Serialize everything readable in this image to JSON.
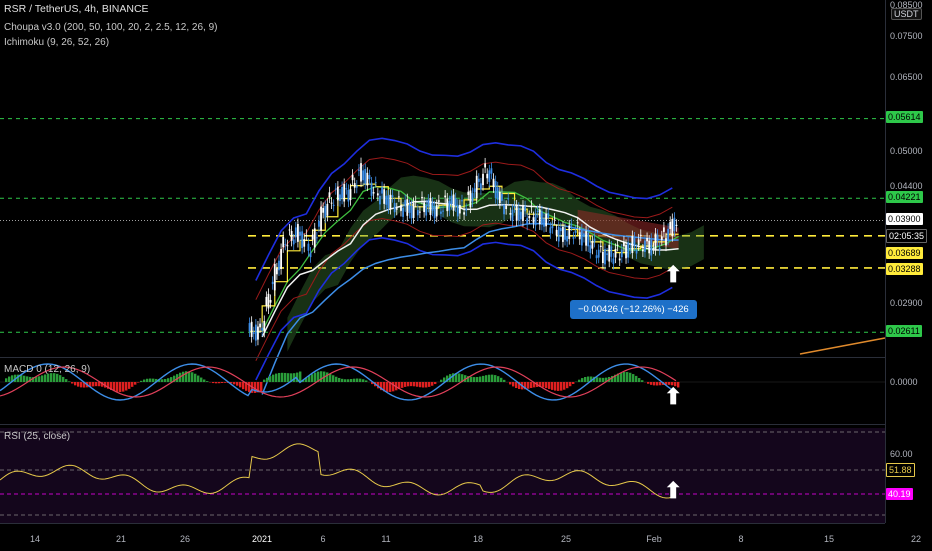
{
  "header": {
    "title": "RSR / TetherUS, 4h, BINANCE",
    "indicator1": "Choupa v3.0 (200, 50, 100, 20, 2, 2.5, 12, 26, 9)",
    "indicator2": "Ichimoku (9, 26, 52, 26)"
  },
  "price_axis": {
    "currency": "USDT",
    "ticks": [
      "0.08500",
      "0.07500",
      "0.06500",
      "0.05000",
      "0.04400",
      "0.02900"
    ],
    "tags": {
      "top_green": "0.05614",
      "upper_green": "0.04221",
      "last": "0.03900",
      "countdown": "02:05:35",
      "yellow_upper": "0.03689",
      "yellow_lower": "0.03288",
      "bottom_green": "0.02611"
    }
  },
  "measure_label": "−0.00426 (−12.26%) −426",
  "macd": {
    "label": "MACD 0 (12, 26, 9)",
    "zero": "0.0000"
  },
  "rsi": {
    "label": "RSI (25, close)",
    "tick": "60.00",
    "value": "51.88",
    "band": "40.19"
  },
  "date_axis": [
    "14",
    "21",
    "26",
    "2021",
    "6",
    "11",
    "18",
    "25",
    "Feb",
    "8",
    "15",
    "22"
  ],
  "colors": {
    "green_level": "#2ec84a",
    "yellow_level": "#ffeb3b",
    "band_blue": "#1e2ee0",
    "band_red": "#9b1a1a",
    "ema_white": "#f2f2f2",
    "ema_green": "#3fbf3f",
    "ema_blue": "#3d8ee8",
    "rsi_line": "#e6c84a",
    "rsi_bg": "#1e0a26",
    "magenta": "#ff00ff",
    "measure_bg": "#1e70c8"
  },
  "chart_data": {
    "type": "line",
    "title": "RSR / TetherUS, 4h, BINANCE",
    "x_range": [
      "Dec 11",
      "Feb 22"
    ],
    "ylim": [
      0.026,
      0.0855
    ],
    "y_scale": "log",
    "series": [
      {
        "name": "RSR / TetherUS",
        "x": [
          "Dec 31",
          "Jan 1",
          "Jan 2",
          "Jan 3",
          "Jan 4",
          "Jan 5",
          "Jan 6",
          "Jan 7",
          "Jan 8",
          "Jan 9",
          "Jan 10",
          "Jan 11",
          "Jan 12",
          "Jan 13",
          "Jan 14",
          "Jan 15",
          "Jan 16",
          "Jan 17",
          "Jan 18",
          "Jan 19",
          "Jan 20",
          "Jan 21",
          "Jan 22",
          "Jan 23",
          "Jan 24",
          "Jan 25",
          "Jan 26",
          "Jan 27",
          "Jan 28",
          "Jan 29",
          "Jan 30",
          "Jan 31",
          "Feb 1",
          "Feb 2"
        ],
        "values": [
          0.0262,
          0.0312,
          0.0365,
          0.0372,
          0.0352,
          0.0405,
          0.0428,
          0.0432,
          0.0465,
          0.0435,
          0.042,
          0.0411,
          0.0405,
          0.0412,
          0.0405,
          0.0418,
          0.0405,
          0.0436,
          0.0468,
          0.0418,
          0.0402,
          0.0398,
          0.0396,
          0.0385,
          0.0369,
          0.0378,
          0.036,
          0.0345,
          0.0345,
          0.0352,
          0.036,
          0.0355,
          0.0368,
          0.039
        ]
      }
    ],
    "horizontal_levels": [
      0.05614,
      0.04221,
      0.03689,
      0.03288,
      0.02611
    ]
  }
}
